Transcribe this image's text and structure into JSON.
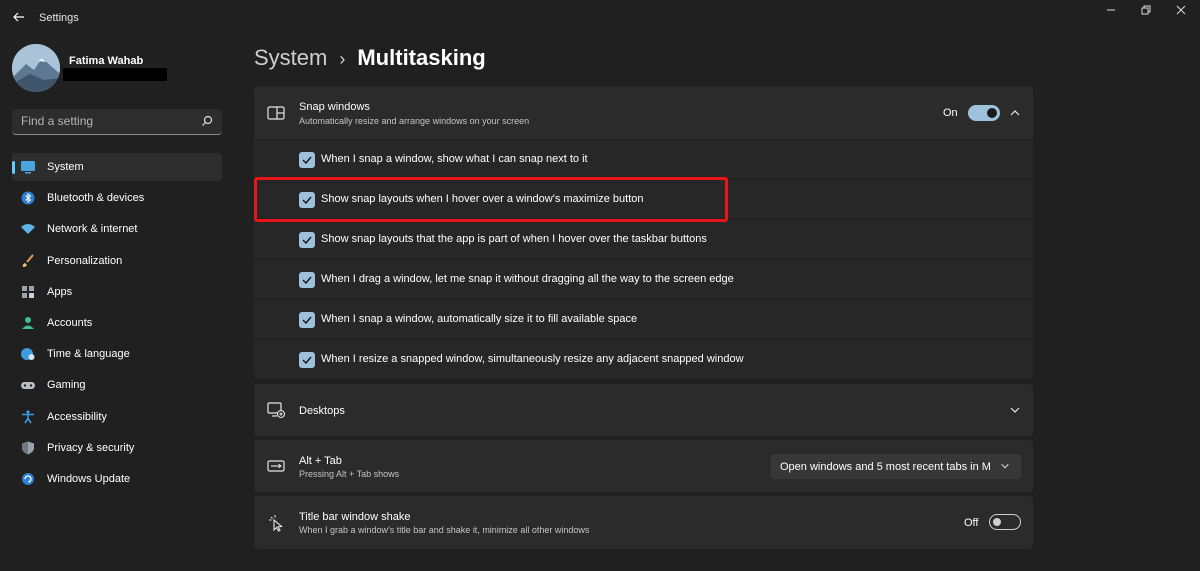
{
  "window": {
    "title": "Settings",
    "controls": [
      "minimize",
      "maximize",
      "close"
    ]
  },
  "user": {
    "name": "Fatima Wahab"
  },
  "search": {
    "placeholder": "Find a setting"
  },
  "sidebar": {
    "items": [
      {
        "label": "System",
        "icon": "monitor-icon",
        "selected": true
      },
      {
        "label": "Bluetooth & devices",
        "icon": "bluetooth-icon"
      },
      {
        "label": "Network & internet",
        "icon": "wifi-icon"
      },
      {
        "label": "Personalization",
        "icon": "brush-icon"
      },
      {
        "label": "Apps",
        "icon": "apps-icon"
      },
      {
        "label": "Accounts",
        "icon": "person-icon"
      },
      {
        "label": "Time & language",
        "icon": "globe-clock-icon"
      },
      {
        "label": "Gaming",
        "icon": "gamepad-icon"
      },
      {
        "label": "Accessibility",
        "icon": "accessibility-icon"
      },
      {
        "label": "Privacy & security",
        "icon": "shield-icon"
      },
      {
        "label": "Windows Update",
        "icon": "update-icon"
      }
    ]
  },
  "breadcrumb": {
    "parent": "System",
    "separator": "›",
    "current": "Multitasking"
  },
  "snap": {
    "title": "Snap windows",
    "subtitle": "Automatically resize and arrange windows on your screen",
    "toggle_label": "On",
    "toggle_on": true,
    "expanded": true,
    "options": [
      {
        "label": "When I snap a window, show what I can snap next to it",
        "checked": true
      },
      {
        "label": "Show snap layouts when I hover over a window's maximize button",
        "checked": true,
        "highlighted": true
      },
      {
        "label": "Show snap layouts that the app is part of when I hover over the taskbar buttons",
        "checked": true
      },
      {
        "label": "When I drag a window, let me snap it without dragging all the way to the screen edge",
        "checked": true
      },
      {
        "label": "When I snap a window, automatically size it to fill available space",
        "checked": true
      },
      {
        "label": "When I resize a snapped window, simultaneously resize any adjacent snapped window",
        "checked": true
      }
    ]
  },
  "desktops": {
    "title": "Desktops"
  },
  "alttab": {
    "title": "Alt + Tab",
    "subtitle": "Pressing Alt + Tab shows",
    "value": "Open windows and 5 most recent tabs in M"
  },
  "shake": {
    "title": "Title bar window shake",
    "subtitle": "When I grab a window's title bar and shake it, minimize all other windows",
    "toggle_label": "Off",
    "toggle_on": false
  },
  "colors": {
    "background": "#202020",
    "card": "#2b2b2b",
    "accent": "#9ec2da",
    "selection_indicator": "#60cdff",
    "highlight": "#e8151b"
  }
}
